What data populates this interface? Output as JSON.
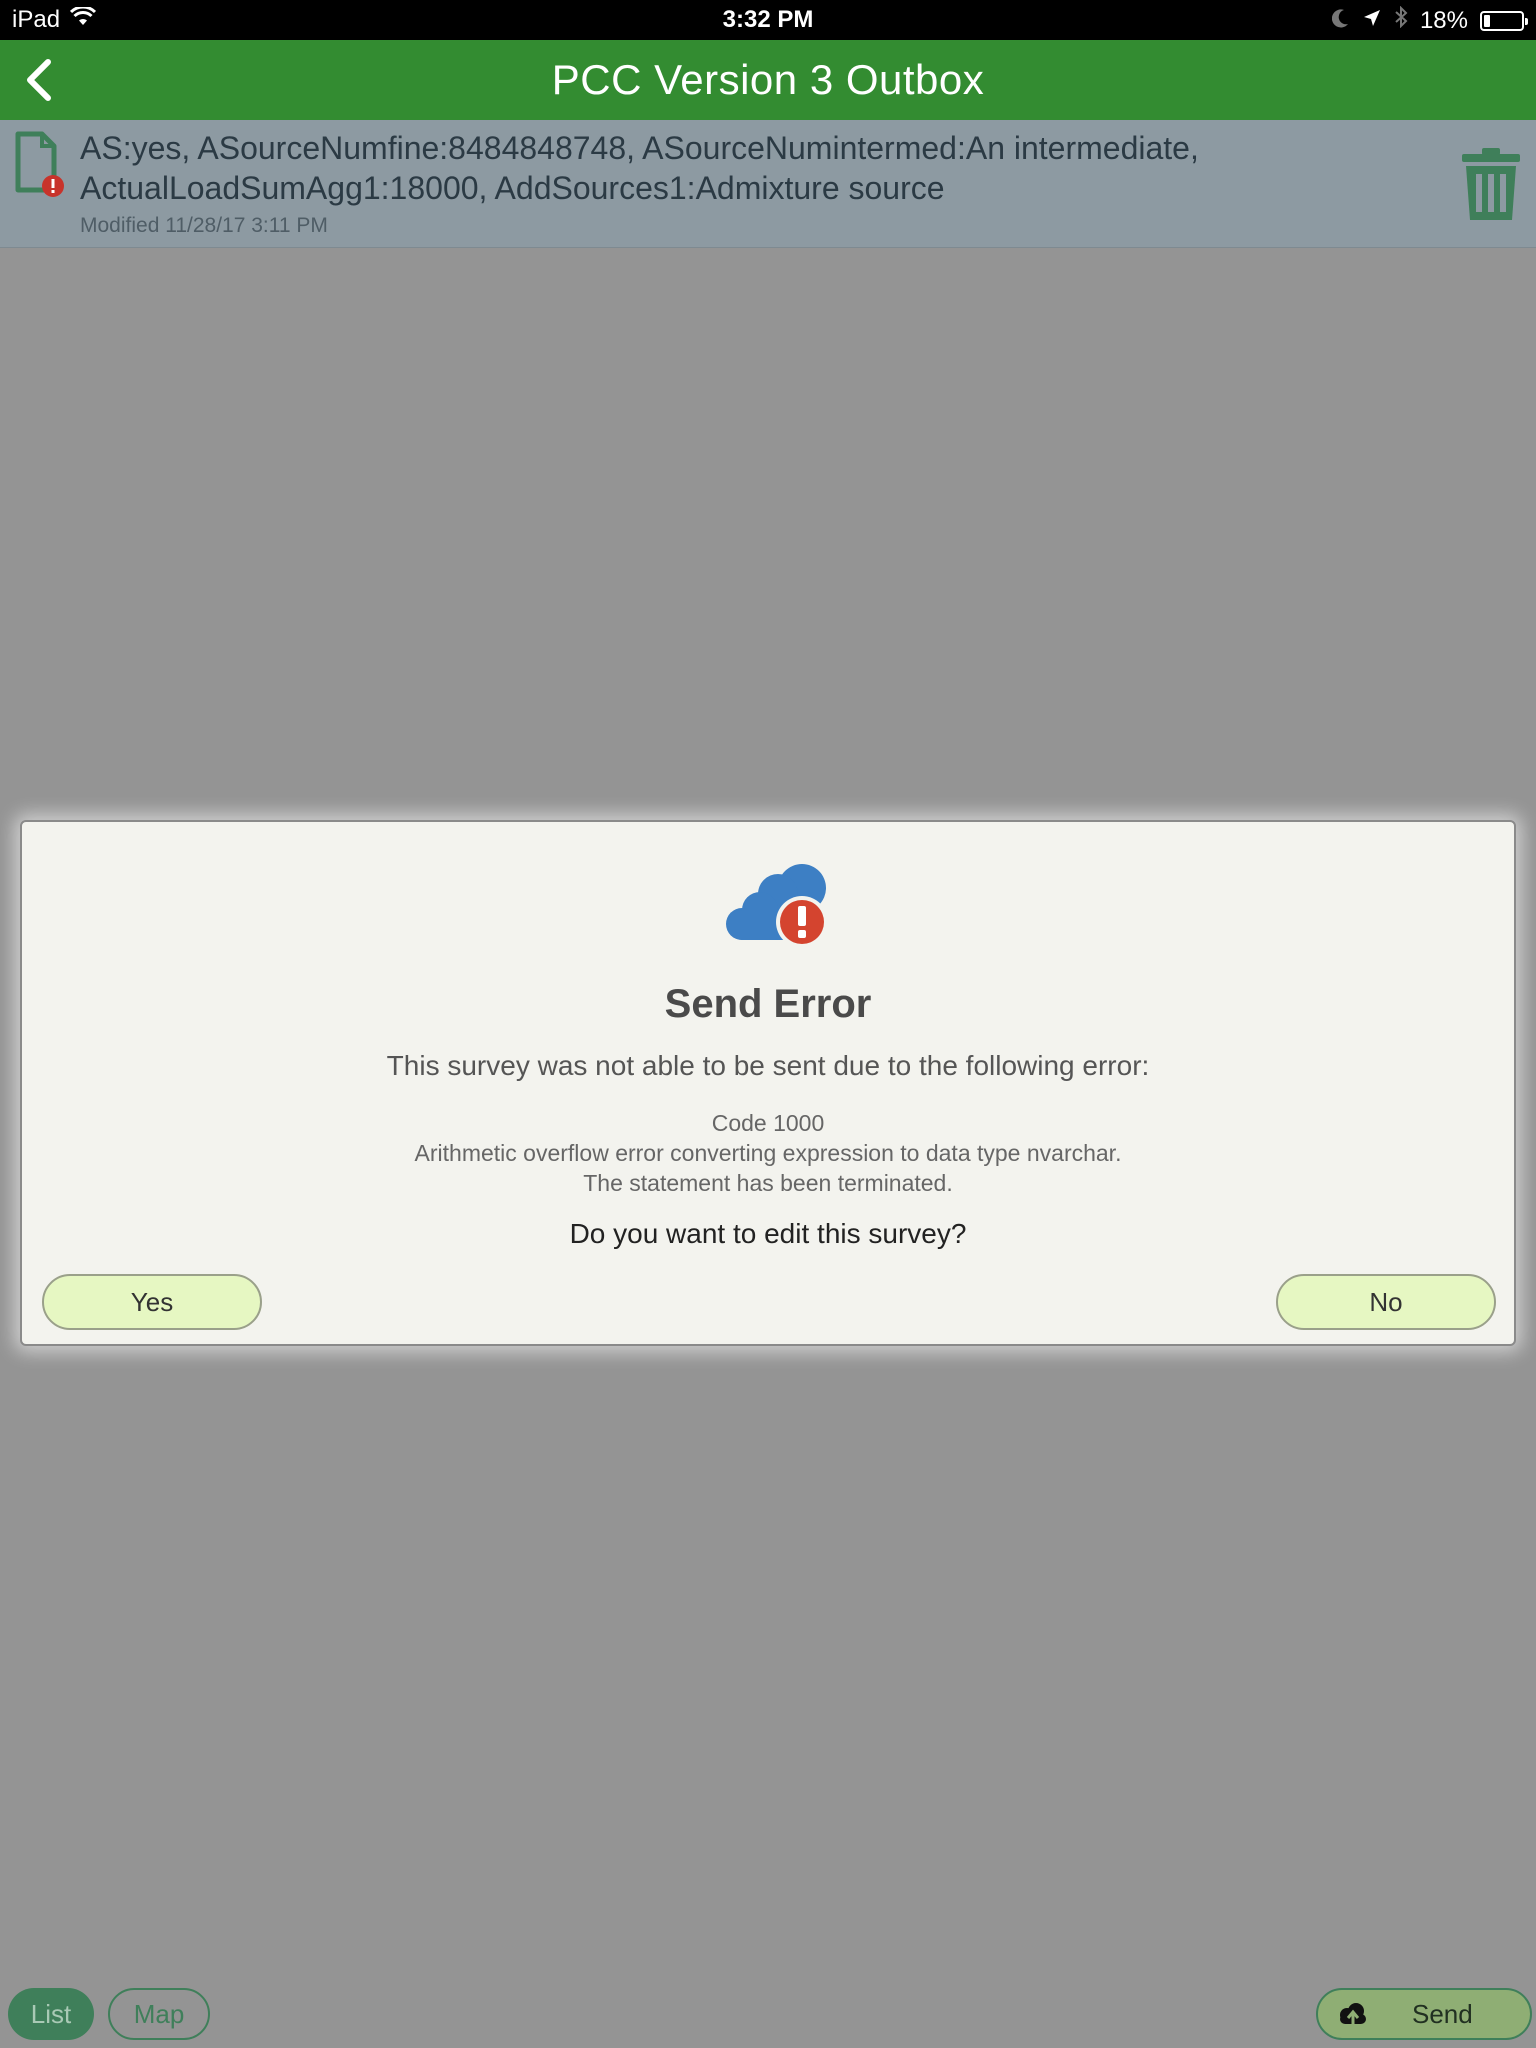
{
  "status_bar": {
    "device": "iPad",
    "time": "3:32 PM",
    "battery_percent": "18%",
    "battery_level": 0.18
  },
  "nav": {
    "title": "PCC Version 3 Outbox"
  },
  "outbox_item": {
    "summary": "AS:yes, ASourceNumfine:8484848748, ASourceNumintermed:An intermediate, ActualLoadSumAgg1:18000, AddSources1:Admixture source",
    "modified": "Modified 11/28/17 3:11 PM"
  },
  "dialog": {
    "title": "Send Error",
    "message": "This survey was not able to be sent due to the following error:",
    "error_code": "Code 1000",
    "error_line1": "Arithmetic overflow error converting expression to data type nvarchar.",
    "error_line2": "The statement has been terminated.",
    "question": "Do you want to edit this survey?",
    "yes_label": "Yes",
    "no_label": "No"
  },
  "toolbar": {
    "list_label": "List",
    "map_label": "Map",
    "send_label": "Send"
  },
  "colors": {
    "nav_green": "#338c31",
    "cloud_blue": "#3d7fc4",
    "error_red": "#d4442f",
    "button_green": "#e6f7c2",
    "icon_green": "#3f7f5a"
  }
}
